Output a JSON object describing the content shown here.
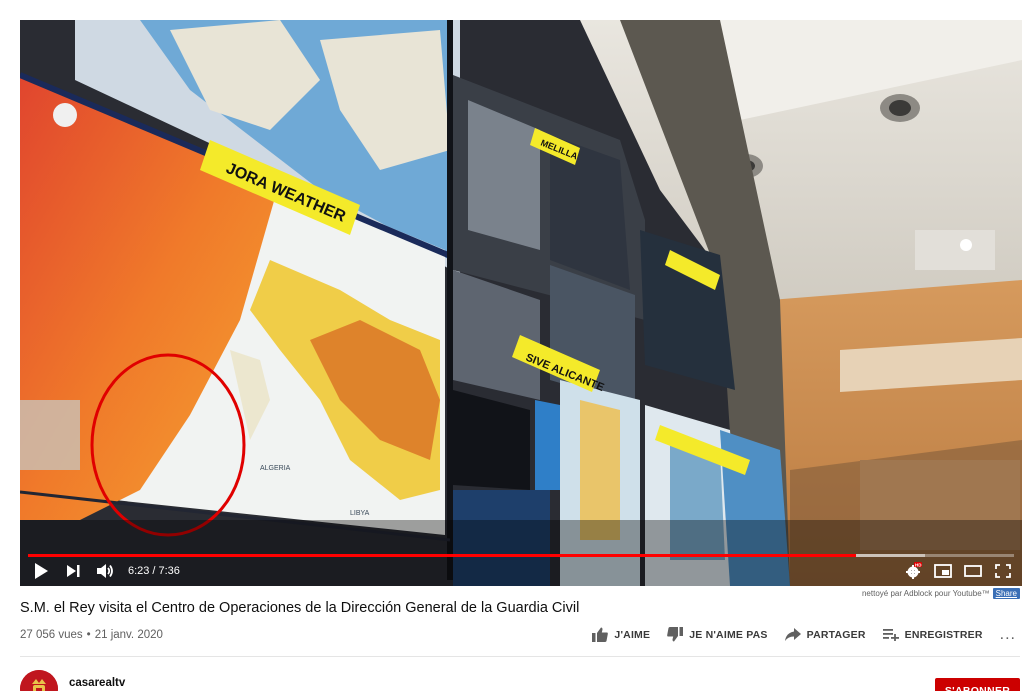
{
  "player": {
    "time_current": "6:23",
    "time_separator": "/",
    "time_total": "7:36",
    "progress_played_fraction": 0.84,
    "progress_loaded_fraction": 0.91,
    "icons": {
      "play": "play-icon",
      "next": "next-icon",
      "volume": "volume-icon",
      "settings": "settings-gear-icon",
      "hd_badge": "HD",
      "miniplayer": "miniplayer-icon",
      "theater": "theater-mode-icon",
      "fullscreen": "fullscreen-icon"
    },
    "scene_labels": {
      "weather": "JORA WEATHER",
      "melilla": "MELILLA",
      "sive": "SIVE ALICANTE",
      "algeria": "ALGERIA",
      "libya": "LIBYA"
    },
    "accent_color": "#ff0000",
    "annotation_circle_color": "#e00000"
  },
  "adblock": {
    "text": "nettoyé par Adblock pour Youtube™",
    "share_label": "Share"
  },
  "video": {
    "title": "S.M. el Rey visita el Centro de Operaciones de la Dirección General de la Guardia Civil",
    "views": "27 056 vues",
    "separator": "•",
    "date": "21 janv. 2020"
  },
  "actions": {
    "like": "J'AIME",
    "dislike": "JE N'AIME PAS",
    "share": "PARTAGER",
    "save": "ENREGISTRER",
    "more": "..."
  },
  "channel": {
    "name": "casarealtv",
    "subscribe_label": "S'ABONNER",
    "subscribe_color": "#cc0000"
  }
}
